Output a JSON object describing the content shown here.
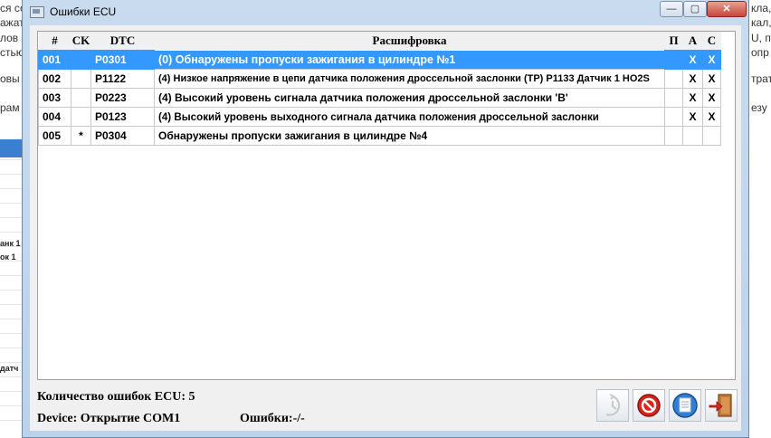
{
  "background": {
    "lines": [
      {
        "text": "ся со",
        "row": 0
      },
      {
        "text": "ажат",
        "row": 1
      },
      {
        "text": "лов",
        "row": 2
      },
      {
        "text": "стью",
        "row": 3
      },
      {
        "text": "овы",
        "row": 4
      },
      {
        "text": "рам",
        "row": 5
      }
    ],
    "right_lines": [
      "кла,",
      "кал,",
      "U, п",
      "опр",
      "трате",
      "езу"
    ],
    "side_labels": [
      "анк 1",
      "ок 1",
      "датч"
    ]
  },
  "window": {
    "title": "Ошибки ECU",
    "controls": {
      "minimize": "—",
      "maximize": "▢",
      "close": "✕"
    }
  },
  "table": {
    "columns": {
      "num": "#",
      "ck": "CK",
      "dtc": "DTC",
      "desc": "Расшифровка",
      "p": "П",
      "a": "А",
      "c": "С"
    },
    "rows": [
      {
        "num": "001",
        "ck": "",
        "dtc": "P0301",
        "desc": "(0) Обнаружены пропуски зажигания в цилиндре №1",
        "p": "",
        "a": "X",
        "c": "X"
      },
      {
        "num": "002",
        "ck": "",
        "dtc": "P1122",
        "desc": "(4) Низкое напряжение в цепи датчика положения дроссельной заслонки (TP) P1133 Датчик 1 HO2S",
        "p": "",
        "a": "X",
        "c": "X"
      },
      {
        "num": "003",
        "ck": "",
        "dtc": "P0223",
        "desc": "(4) Высокий уровень сигнала датчика положения дроссельной заслонки 'B'",
        "p": "",
        "a": "X",
        "c": "X"
      },
      {
        "num": "004",
        "ck": "",
        "dtc": "P0123",
        "desc": "(4) Высокий уровень выходного сигнала датчика положения дроссельной заслонки",
        "p": "",
        "a": "X",
        "c": "X"
      },
      {
        "num": "005",
        "ck": "*",
        "dtc": "P0304",
        "desc": "Обнаружены пропуски зажигания в цилиндре №4",
        "p": "",
        "a": "",
        "c": ""
      }
    ]
  },
  "footer": {
    "count_label": "Количество ошибок ECU: 5",
    "device_label": "Device: Открытие COM1",
    "errors_label": "Ошибки:-/-"
  },
  "toolbar": {
    "icons": [
      "history-icon",
      "clear-errors-icon",
      "save-icon",
      "exit-icon"
    ]
  }
}
